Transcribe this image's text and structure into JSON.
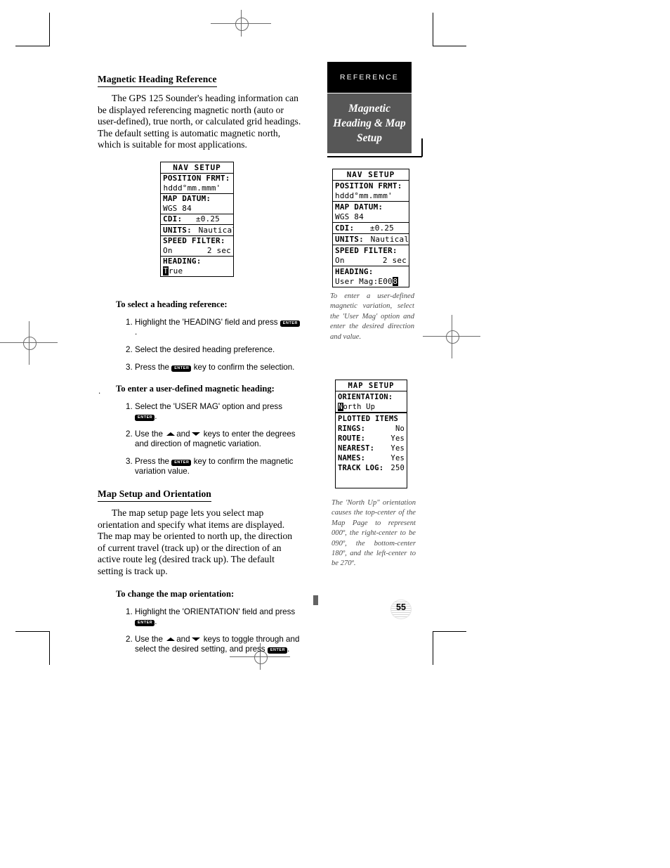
{
  "page": {
    "number": "55",
    "section_tab": "REFERENCE",
    "section_title_lines": [
      "Magnetic",
      "Heading & Map",
      "Setup"
    ]
  },
  "left_column": {
    "section1": {
      "heading": "Magnetic Heading Reference",
      "body": "The GPS 125 Sounder's heading information can be displayed referencing magnetic north (auto or user-defined), true north, or calculated grid headings. The default setting is automatic magnetic north, which is suitable for most applications."
    },
    "procedure1": {
      "title": "To select a heading reference:",
      "steps": [
        {
          "num": "1.",
          "pre": "Highlight the 'HEADING' field and press ",
          "key": "ENTER",
          "post": "."
        },
        {
          "num": "2.",
          "pre": "Select the desired heading preference.",
          "key": "",
          "post": ""
        },
        {
          "num": "3.",
          "pre": "Press the ",
          "key": "ENTER",
          "post": " key to confirm the selection."
        }
      ]
    },
    "procedure2": {
      "title": "To enter a user-defined magnetic heading:",
      "stray_mark": ".",
      "steps": [
        {
          "num": "1.",
          "pre": "Select the 'USER MAG' option and press ",
          "key": "ENTER",
          "post": "."
        },
        {
          "num": "2.",
          "pre": "Use the ",
          "key": "ARROWS",
          "post": " keys to enter the degrees and direction of magnetic variation.",
          "and_word": "and"
        },
        {
          "num": "3.",
          "pre": "Press the ",
          "key": "ENTER",
          "post": " key to confirm the magnetic variation value."
        }
      ]
    },
    "section2": {
      "heading": "Map Setup and Orientation",
      "body": "The map setup page lets you select map orientation and specify what items are displayed. The map may be oriented to north up, the direction of current travel (track up) or the direction of an active route leg (desired track up). The default setting is track up."
    },
    "procedure3": {
      "title": "To change the map orientation:",
      "steps": [
        {
          "num": "1.",
          "pre": "Highlight the 'ORIENTATION' field and press ",
          "key": "ENTER",
          "post": "."
        },
        {
          "num": "2.",
          "pre": "Use the ",
          "key": "ARROWS",
          "post": " keys to toggle through and select the desired setting, and press ",
          "and_word": "and",
          "post2": "."
        }
      ]
    }
  },
  "screens": {
    "nav_setup_left": {
      "title": "NAV SETUP",
      "rows": [
        {
          "label": "POSITION FRMT:",
          "value": "hddd°mm.mmm'",
          "value_highlighted": true
        },
        {
          "label": "MAP DATUM:",
          "value": "WGS 84"
        },
        {
          "label": "CDI:",
          "value": "±0.25",
          "inline": true
        },
        {
          "label": "UNITS:",
          "value": "Nautical",
          "inline": true
        },
        {
          "label": "SPEED FILTER:",
          "value": "On",
          "value2": "2 sec"
        },
        {
          "label": "HEADING:",
          "value": "True",
          "cursor_char": "T"
        }
      ]
    },
    "nav_setup_right": {
      "title": "NAV SETUP",
      "rows": [
        {
          "label": "POSITION FRMT:",
          "value": "hddd°mm.mmm'"
        },
        {
          "label": "MAP DATUM:",
          "value": "WGS 84"
        },
        {
          "label": "CDI:",
          "value": "±0.25",
          "inline": true
        },
        {
          "label": "UNITS:",
          "value": "Nautical",
          "inline": true
        },
        {
          "label": "SPEED FILTER:",
          "value": "On",
          "value2": "2 sec"
        },
        {
          "label": "HEADING:",
          "value": "User Mag:E00",
          "cursor_suffix": "8"
        }
      ]
    },
    "map_setup": {
      "title": "MAP SETUP",
      "orientation_label": "ORIENTATION:",
      "orientation_value": "North Up",
      "orientation_cursor_char": "N",
      "plotted_items_header": "PLOTTED ITEMS",
      "items": [
        {
          "label": "RINGS:",
          "value": "No"
        },
        {
          "label": "ROUTE:",
          "value": "Yes"
        },
        {
          "label": "NEAREST:",
          "value": "Yes"
        },
        {
          "label": "NAMES:",
          "value": "Yes"
        },
        {
          "label": "TRACK LOG:",
          "value": "250"
        }
      ]
    }
  },
  "captions": {
    "user_mag": "To enter a user-defined magnetic variation, select the 'User Mag' option and enter the desired direction and value.",
    "north_up": "The 'North Up\" orientation causes the top-center of the Map Page to represent 000º, the right-center to be 090º, the bottom-center 180º, and the left-center to be 270º."
  },
  "colors": {
    "tab_bg": "#000000",
    "title_bg": "#575757",
    "caption_text": "#4a4a4a",
    "page_text": "#000000"
  }
}
